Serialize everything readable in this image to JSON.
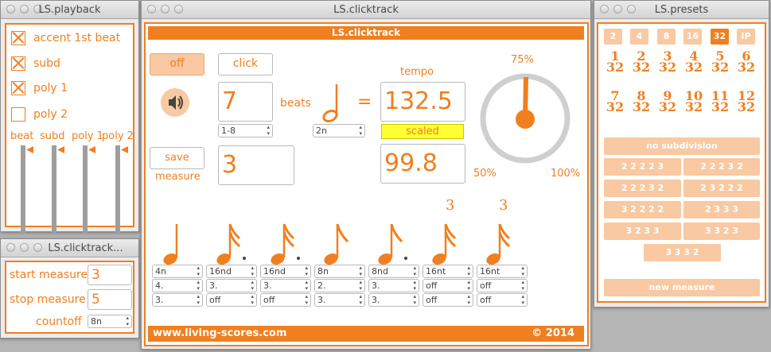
{
  "playback": {
    "title": "LS.playback",
    "checks": [
      {
        "label": "accent 1st beat",
        "checked": true
      },
      {
        "label": "subd",
        "checked": true
      },
      {
        "label": "poly 1",
        "checked": true
      },
      {
        "label": "poly 2",
        "checked": false
      }
    ],
    "sliders": [
      "beat",
      "subd",
      "poly 1",
      "poly 2"
    ]
  },
  "clicktrack_small": {
    "title": "LS.clicktrack...",
    "start_label": "start measure",
    "start_value": "3",
    "stop_label": "stop measure",
    "stop_value": "5",
    "countoff_label": "countoff",
    "countoff_value": "8n"
  },
  "clicktrack": {
    "title": "LS.clicktrack",
    "header": "LS.clicktrack",
    "off_label": "off",
    "click_label": "click",
    "beats_value": "7",
    "beats_label": "beats",
    "beats_menu": "1-8",
    "note_menu": "2n",
    "equals": "=",
    "tempo_label": "tempo",
    "tempo_value": "132.5",
    "scaled_label": "scaled",
    "scaled_value": "99.8",
    "save_label": "save",
    "measure_label": "measure",
    "measure_value": "3",
    "dial_pct": "75%",
    "dial_min": "50%",
    "dial_max": "100%",
    "triplet": "3",
    "columns": [
      [
        "4n",
        "4.",
        "3."
      ],
      [
        "16nd",
        "3.",
        "off"
      ],
      [
        "16nd",
        "3.",
        "off"
      ],
      [
        "8n",
        "2.",
        "3."
      ],
      [
        "8nd",
        "3.",
        "3."
      ],
      [
        "16nt",
        "off",
        "off"
      ],
      [
        "16nt",
        "off",
        "off"
      ]
    ],
    "footer_left": "www.living-scores.com",
    "footer_right": "© 2014"
  },
  "presets": {
    "title": "LS.presets",
    "top_buttons": [
      "2",
      "4",
      "8",
      "16",
      "32",
      "IP"
    ],
    "selected_top": "32",
    "sigs": [
      {
        "num": "1",
        "den": "32"
      },
      {
        "num": "2",
        "den": "32"
      },
      {
        "num": "3",
        "den": "32"
      },
      {
        "num": "4",
        "den": "32"
      },
      {
        "num": "5",
        "den": "32"
      },
      {
        "num": "6",
        "den": "32"
      },
      {
        "num": "7",
        "den": "32"
      },
      {
        "num": "8",
        "den": "32"
      },
      {
        "num": "9",
        "den": "32"
      },
      {
        "num": "10",
        "den": "32"
      },
      {
        "num": "11",
        "den": "32"
      },
      {
        "num": "12",
        "den": "32"
      }
    ],
    "no_subdivision": "no subdivision",
    "patterns": [
      "2 2 2 2 3",
      "2 2 2 3 2",
      "2 2 2 3 2",
      "2 3 2 2 2",
      "3 2 2 2 2",
      "2 3 3 3",
      "3 2 3 3",
      "3 3 2 3",
      "3 3 3 2"
    ],
    "new_measure": "new measure"
  },
  "colors": {
    "accent": "#f07f1f",
    "accent_light": "#f8c9a2",
    "scaled_bg": "#ffff33",
    "dial_ring": "#cfcfcf"
  }
}
